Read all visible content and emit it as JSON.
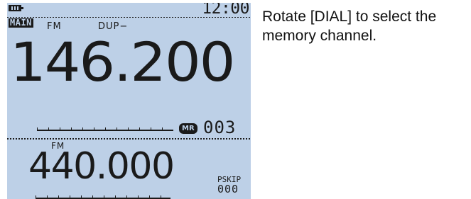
{
  "display": {
    "battery_icon": "battery-full-icon",
    "clock": "12:00",
    "main_label": "MAIN",
    "band_a": {
      "mode": "FM",
      "duplex": "DUP−",
      "frequency": "146.200",
      "memory_badge": "MR",
      "channel": "003"
    },
    "band_b": {
      "mode": "FM",
      "frequency": "440.000",
      "skip_label": "PSKIP",
      "skip_channel": "000"
    }
  },
  "instruction": {
    "text": "Rotate [DIAL] to select the memory channel."
  },
  "colors": {
    "lcd_background": "#bdd0e7",
    "lcd_segment": "#1a1a1a"
  }
}
